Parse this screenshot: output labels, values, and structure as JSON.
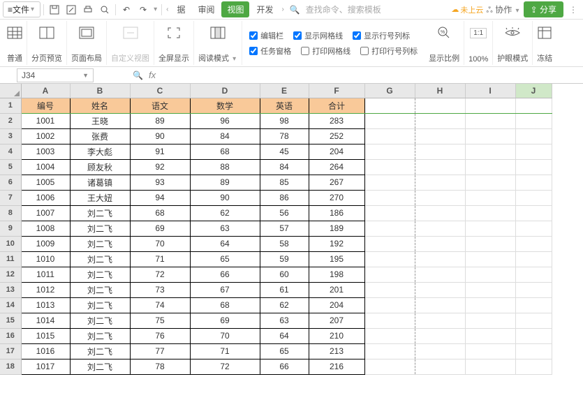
{
  "topmenu": {
    "file": "文件",
    "tabs": [
      "据",
      "审阅",
      "视图",
      "开发"
    ],
    "active_tab_index": 2,
    "search_placeholder": "查找命令、搜索模板",
    "cloud": "未上云",
    "collab": "协作",
    "share": "分享"
  },
  "ribbon": {
    "normal": "普通",
    "page_preview": "分页预览",
    "page_layout": "页面布局",
    "custom_view": "自定义视图",
    "fullscreen": "全屏显示",
    "reading_mode": "阅读模式",
    "edit_bar": "编辑栏",
    "task_pane": "任务窗格",
    "show_grid": "显示网格线",
    "print_grid": "打印网格线",
    "show_rowcol": "显示行号列标",
    "print_rowcol": "打印行号列标",
    "zoom": "显示比例",
    "pct": "100%",
    "eye_mode": "护眼模式",
    "freeze": "冻结"
  },
  "namebox": "J34",
  "fx": "fx",
  "columns": [
    "A",
    "B",
    "C",
    "D",
    "E",
    "F",
    "G",
    "H",
    "I",
    "J"
  ],
  "selected_col": "J",
  "headers": [
    "编号",
    "姓名",
    "语文",
    "数学",
    "英语",
    "合计"
  ],
  "rows": [
    [
      "1001",
      "王晓",
      "89",
      "96",
      "98",
      "283"
    ],
    [
      "1002",
      "张费",
      "90",
      "84",
      "78",
      "252"
    ],
    [
      "1003",
      "李大彪",
      "91",
      "68",
      "45",
      "204"
    ],
    [
      "1004",
      "顾友秋",
      "92",
      "88",
      "84",
      "264"
    ],
    [
      "1005",
      "诸葛镇",
      "93",
      "89",
      "85",
      "267"
    ],
    [
      "1006",
      "王大妞",
      "94",
      "90",
      "86",
      "270"
    ],
    [
      "1007",
      "刘二飞",
      "68",
      "62",
      "56",
      "186"
    ],
    [
      "1008",
      "刘二飞",
      "69",
      "63",
      "57",
      "189"
    ],
    [
      "1009",
      "刘二飞",
      "70",
      "64",
      "58",
      "192"
    ],
    [
      "1010",
      "刘二飞",
      "71",
      "65",
      "59",
      "195"
    ],
    [
      "1011",
      "刘二飞",
      "72",
      "66",
      "60",
      "198"
    ],
    [
      "1012",
      "刘二飞",
      "73",
      "67",
      "61",
      "201"
    ],
    [
      "1013",
      "刘二飞",
      "74",
      "68",
      "62",
      "204"
    ],
    [
      "1014",
      "刘二飞",
      "75",
      "69",
      "63",
      "207"
    ],
    [
      "1015",
      "刘二飞",
      "76",
      "70",
      "64",
      "210"
    ],
    [
      "1016",
      "刘二飞",
      "77",
      "71",
      "65",
      "213"
    ],
    [
      "1017",
      "刘二飞",
      "78",
      "72",
      "66",
      "216"
    ]
  ]
}
